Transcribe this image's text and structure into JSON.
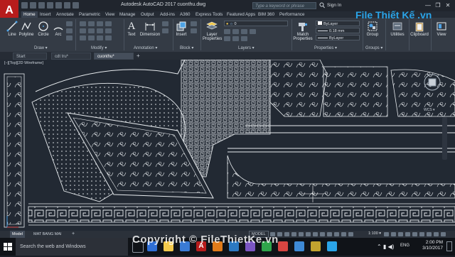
{
  "window": {
    "title": "Autodesk AutoCAD 2017    cuonthu.dwg",
    "search_placeholder": "Type a keyword or phrase",
    "signin": "Sign In",
    "controls": [
      "—",
      "❐",
      "✕"
    ]
  },
  "ribbon_tabs": [
    "Home",
    "Insert",
    "Annotate",
    "Parametric",
    "View",
    "Manage",
    "Output",
    "Add-ins",
    "A360",
    "Express Tools",
    "Featured Apps",
    "BIM 360",
    "Performance"
  ],
  "active_ribbon_tab": "Home",
  "ribbon": {
    "draw": {
      "title": "Draw ▾",
      "tools": [
        "Line",
        "Polyline",
        "Circle",
        "Arc"
      ]
    },
    "modify": {
      "title": "Modify ▾"
    },
    "annotation": {
      "title": "Annotation ▾",
      "tools": [
        "Text",
        "Dimension"
      ]
    },
    "block": {
      "title": "Block ▾",
      "tools": [
        "Insert"
      ]
    },
    "layers": {
      "title": "Layers ▾",
      "tools": [
        "Layer Properties"
      ],
      "layer_combo": "0"
    },
    "match": {
      "label": "Match Properties"
    },
    "properties": {
      "title": "Properties ▾",
      "color": "ByLayer",
      "lineweight": "0.18 mm",
      "linetype": "ByLayer"
    },
    "groups": {
      "title": "Groups ▾",
      "tools": [
        "Group"
      ]
    },
    "utilities": {
      "label": "Utilities"
    },
    "clipboard": {
      "label": "Clipboard"
    },
    "view": {
      "label": "View"
    }
  },
  "doc_tabs": [
    "Start",
    "cdt tru*",
    "cuonthu*"
  ],
  "active_doc_tab": "cuonthu*",
  "viewport_label": "[–][Top][2D Wireframe]",
  "wcs_label": "WCS ▾",
  "status": {
    "tabs": [
      "Model",
      "MAT BANG MAI"
    ],
    "active_tab": "Model",
    "model_button": "MODEL",
    "scale": "1:100 ▾"
  },
  "taskbar": {
    "search_placeholder": "Search the web and Windows",
    "language": "ENG",
    "time": "2:00 PM",
    "date": "3/10/2017"
  },
  "watermark": {
    "logo": "File Thiết Kế .vn",
    "footer": "Copyright © FileThietKe.vn"
  },
  "colors": {
    "canvas": "#222933",
    "ribbon": "#343b45",
    "line": "#e8ecef",
    "brand_blue": "#2aa4e8",
    "app_red": "#b71c1c"
  }
}
